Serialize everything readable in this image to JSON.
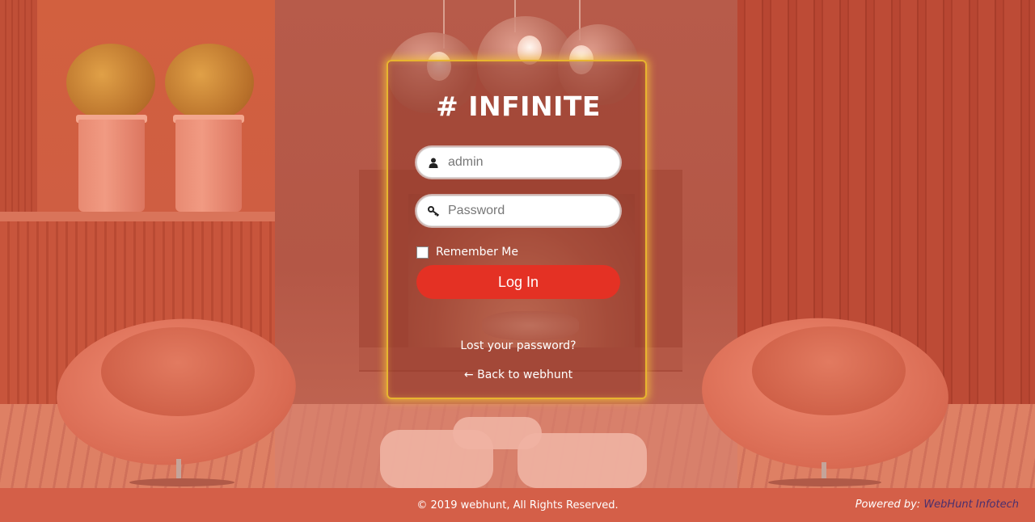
{
  "login": {
    "brand": "# INFINITE",
    "username_placeholder": "admin",
    "password_placeholder": "Password",
    "remember_label": "Remember Me",
    "login_button": "Log In",
    "lost_password": "Lost your password?",
    "back_link": "← Back to webhunt"
  },
  "footer": {
    "copyright": "© 2019 webhunt, All Rights Reserved.",
    "powered_label": "Powered by:",
    "powered_company": "WebHunt Infotech"
  },
  "icons": {
    "username": "user-icon",
    "password": "key-icon"
  },
  "colors": {
    "accent": "#e43124",
    "card_border": "#e8b52f",
    "footer_bg": "#d45f48"
  }
}
